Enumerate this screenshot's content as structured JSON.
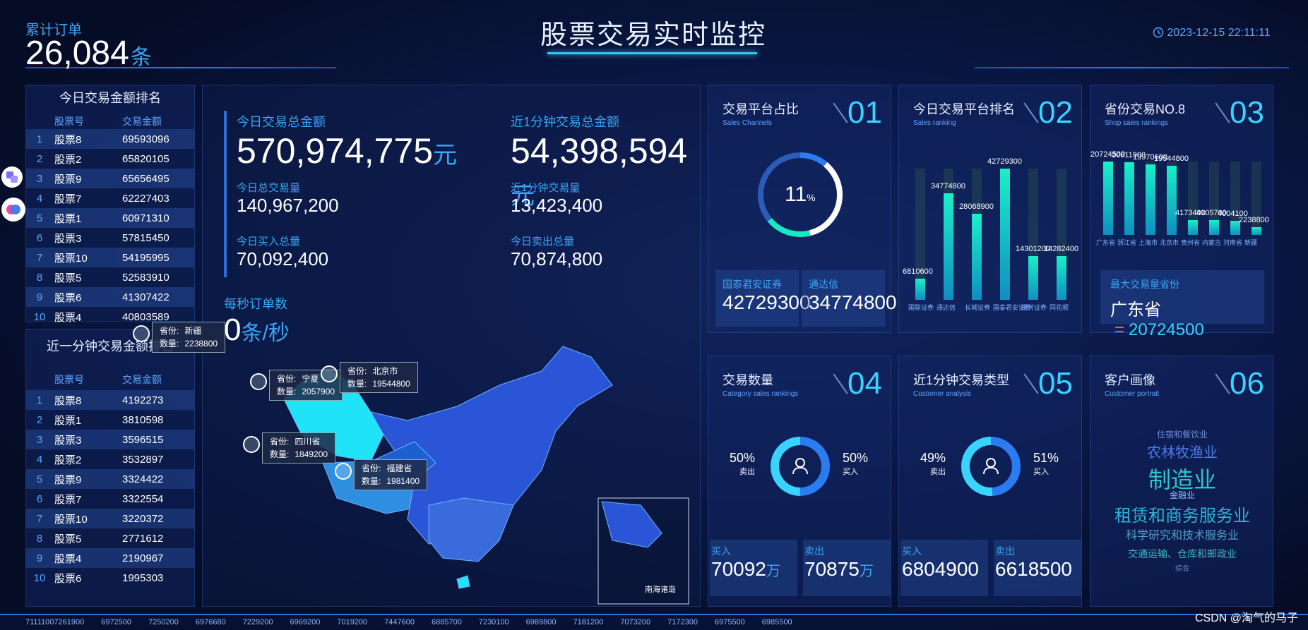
{
  "header": {
    "title": "股票交易实时监控",
    "orders_label": "累计订单",
    "orders_value": "26,084",
    "orders_unit": "条",
    "clock": "2023-12-15 22:11:11",
    "clock_icon": "clock-icon"
  },
  "today_rank": {
    "title": "今日交易金额排名",
    "col_code": "股票号",
    "col_amount": "交易金额",
    "rows": [
      {
        "idx": "1",
        "name": "股票8",
        "amount": "69593096"
      },
      {
        "idx": "2",
        "name": "股票2",
        "amount": "65820105"
      },
      {
        "idx": "3",
        "name": "股票9",
        "amount": "65656495"
      },
      {
        "idx": "4",
        "name": "股票7",
        "amount": "62227403"
      },
      {
        "idx": "5",
        "name": "股票1",
        "amount": "60971310"
      },
      {
        "idx": "6",
        "name": "股票3",
        "amount": "57815450"
      },
      {
        "idx": "7",
        "name": "股票10",
        "amount": "54195995"
      },
      {
        "idx": "8",
        "name": "股票5",
        "amount": "52583910"
      },
      {
        "idx": "9",
        "name": "股票6",
        "amount": "41307422"
      },
      {
        "idx": "10",
        "name": "股票4",
        "amount": "40803589"
      }
    ]
  },
  "minute_rank": {
    "title": "近一分钟交易金额排名",
    "col_code": "股票号",
    "col_amount": "交易金额",
    "rows": [
      {
        "idx": "1",
        "name": "股票8",
        "amount": "4192273"
      },
      {
        "idx": "2",
        "name": "股票1",
        "amount": "3810598"
      },
      {
        "idx": "3",
        "name": "股票3",
        "amount": "3596515"
      },
      {
        "idx": "4",
        "name": "股票2",
        "amount": "3532897"
      },
      {
        "idx": "5",
        "name": "股票9",
        "amount": "3324422"
      },
      {
        "idx": "6",
        "name": "股票7",
        "amount": "3322554"
      },
      {
        "idx": "7",
        "name": "股票10",
        "amount": "3220372"
      },
      {
        "idx": "8",
        "name": "股票5",
        "amount": "2771612"
      },
      {
        "idx": "9",
        "name": "股票4",
        "amount": "2190967"
      },
      {
        "idx": "10",
        "name": "股票6",
        "amount": "1995303"
      }
    ]
  },
  "center": {
    "today_total_label": "今日交易总金额",
    "today_total_value": "570,974,775",
    "today_total_unit": "元",
    "minute_total_label": "近1分钟交易总金额",
    "minute_total_value": "54,398,594",
    "minute_total_unit": "元",
    "today_volume_label": "今日总交易量",
    "today_volume_value": "140,967,200",
    "minute_volume_label": "近1分钟交易量",
    "minute_volume_value": "13,423,400",
    "buy_label": "今日买入总量",
    "buy_value": "70,092,400",
    "sell_label": "今日卖出总量",
    "sell_value": "70,874,800",
    "ops_label": "每秒订单数",
    "ops_value": "0",
    "ops_unit": "条/秒"
  },
  "map": {
    "islands_label": "南海诸岛",
    "tooltips": [
      {
        "province_label": "省份:",
        "province": "新疆",
        "count_label": "数量:",
        "count": "2238800"
      },
      {
        "province_label": "省份:",
        "province": "宁夏",
        "count_label": "数量:",
        "count": "2057900"
      },
      {
        "province_label": "省份:",
        "province": "北京市",
        "count_label": "数量:",
        "count": "19544800"
      },
      {
        "province_label": "省份:",
        "province": "四川省",
        "count_label": "数量:",
        "count": "1849200"
      },
      {
        "province_label": "省份:",
        "province": "福建省",
        "count_label": "数量:",
        "count": "1981400"
      }
    ]
  },
  "panel01": {
    "title": "交易平台占比",
    "subtitle": "Sales Channels",
    "number": "01",
    "percent": "11",
    "percent_unit": "%",
    "stat1_label": "国泰君安证券",
    "stat1_value": "42729300",
    "stat2_label": "通达信",
    "stat2_value": "34774800"
  },
  "panel02": {
    "title": "今日交易平台排名",
    "subtitle": "Sales ranking",
    "number": "02"
  },
  "panel03": {
    "title": "省份交易NO.8",
    "subtitle": "Shop sales rankings",
    "number": "03",
    "max_label": "最大交易量省份",
    "max_province": "广东省",
    "max_eq": "=",
    "max_value": "20724500"
  },
  "panel04": {
    "title": "交易数量",
    "subtitle": "Category sales rankings",
    "number": "04",
    "left_pct": "50%",
    "left_label": "卖出",
    "right_pct": "50%",
    "right_label": "买入",
    "buy_label": "买入",
    "buy_value": "70092",
    "buy_unit": "万",
    "sell_label": "卖出",
    "sell_value": "70875",
    "sell_unit": "万",
    "user_icon": "user-icon"
  },
  "panel05": {
    "title": "近1分钟交易类型",
    "subtitle": "Customer analysis",
    "number": "05",
    "left_pct": "49%",
    "left_label": "卖出",
    "right_pct": "51%",
    "right_label": "买入",
    "buy_label": "买入",
    "buy_value": "6804900",
    "sell_label": "卖出",
    "sell_value": "6618500",
    "user_icon": "user-icon"
  },
  "panel06": {
    "title": "客户画像",
    "subtitle": "Customer portrait",
    "number": "06",
    "words": [
      "住宿和餐饮业",
      "农林牧渔业",
      "制造业",
      "金融业",
      "租赁和商务服务业",
      "科学研究和技术服务业",
      "交通运输、仓库和邮政业",
      "综合"
    ]
  },
  "ticker": [
    "71111007261900",
    "6972500",
    "7250200",
    "6976680",
    "7229200",
    "6969200",
    "7019200",
    "7447600",
    "6885700",
    "7230100",
    "6989800",
    "7181200",
    "7073200",
    "7172300",
    "6975500",
    "6985500"
  ],
  "watermark": "CSDN @淘气的马子",
  "side_icons": [
    "translate-icon",
    "brain-icon"
  ],
  "chart_data": [
    {
      "type": "bar",
      "title": "今日交易平台排名",
      "categories": [
        "国联证券",
        "通达信",
        "长城证券",
        "国泰君安证券",
        "银河证券",
        "同花顺"
      ],
      "values": [
        6810600,
        34774800,
        28068900,
        42729300,
        14301200,
        14282400
      ],
      "ylim": [
        0,
        42729300
      ]
    },
    {
      "type": "bar",
      "title": "省份交易NO.8",
      "categories": [
        "广东省",
        "浙江省",
        "上海市",
        "北京市",
        "贵州省",
        "内蒙古",
        "河南省",
        "新疆"
      ],
      "values": [
        20724500,
        20611900,
        19970600,
        19544800,
        4173400,
        4105700,
        4004100,
        2238800
      ],
      "ylim": [
        0,
        20724500
      ]
    }
  ],
  "theme": {
    "accent": "#38a6f5",
    "bar_top": "#19f0c9",
    "bar_bottom": "#0f8fc0",
    "bg": "#050c25"
  }
}
